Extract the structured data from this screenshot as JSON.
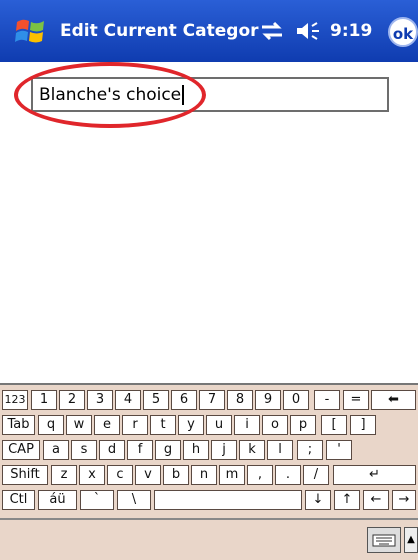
{
  "titlebar": {
    "title": "Edit Current Categor",
    "time": "9:19",
    "ok_label": "ok"
  },
  "form": {
    "category_name_value": "Blanche's choice"
  },
  "keyboard": {
    "rows": [
      [
        "123",
        "1",
        "2",
        "3",
        "4",
        "5",
        "6",
        "7",
        "8",
        "9",
        "0",
        "-",
        "=",
        "⬅"
      ],
      [
        "Tab",
        "q",
        "w",
        "e",
        "r",
        "t",
        "y",
        "u",
        "i",
        "o",
        "p",
        "[",
        "]"
      ],
      [
        "CAP",
        "a",
        "s",
        "d",
        "f",
        "g",
        "h",
        "j",
        "k",
        "l",
        ";",
        "'"
      ],
      [
        "Shift",
        "z",
        "x",
        "c",
        "v",
        "b",
        "n",
        "m",
        ",",
        ".",
        "/",
        "↵"
      ],
      [
        "Ctl",
        "áü",
        "`",
        "\\",
        "",
        "↓",
        "↑",
        "←",
        "→"
      ]
    ]
  },
  "colors": {
    "titlebar": "#1a48c4",
    "highlight": "#e0262b",
    "keyboard_bg": "#e9d6c9"
  },
  "icons": [
    "windows-start-icon",
    "sync-icon",
    "volume-icon",
    "keyboard-icon",
    "chevron-up-icon"
  ]
}
